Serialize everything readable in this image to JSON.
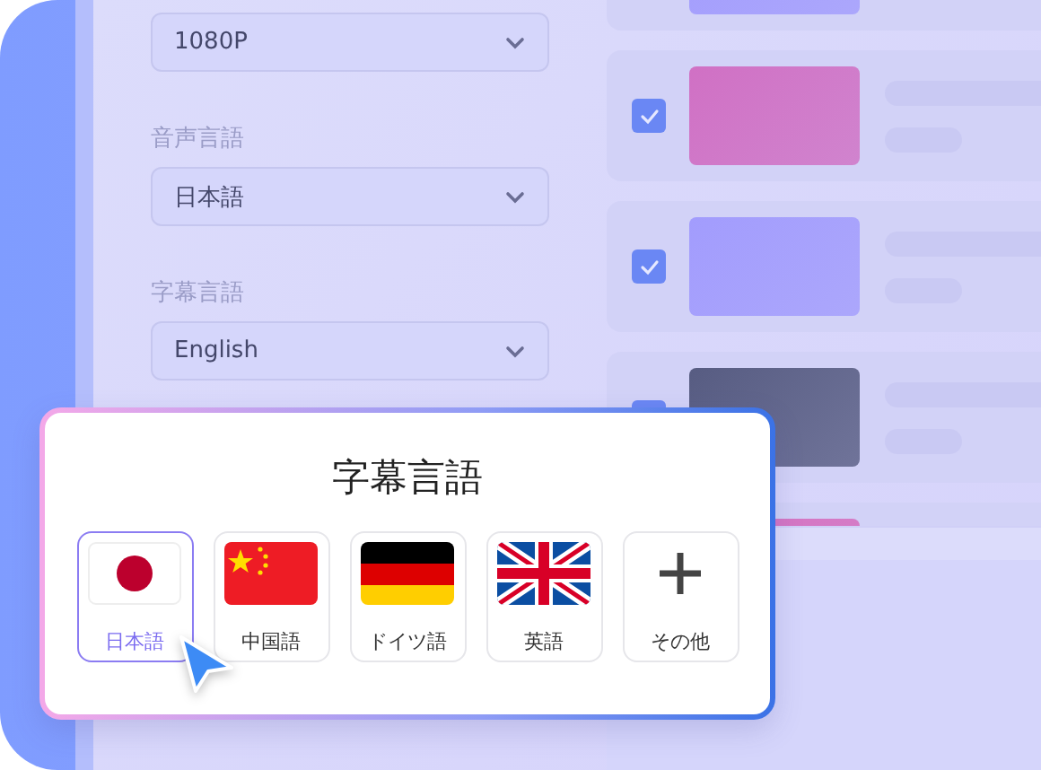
{
  "settings": [
    {
      "value": "1080P"
    },
    {
      "label": "音声言語",
      "value": "日本語"
    },
    {
      "label": "字幕言語",
      "value": "English"
    }
  ],
  "list": {
    "rows": [
      {
        "kind": "top",
        "color": "#a29cfd"
      },
      {
        "kind": "full",
        "checked": true,
        "color": "#d070c4"
      },
      {
        "kind": "full",
        "checked": true,
        "color": "#a29cfd"
      },
      {
        "kind": "overlapped",
        "checked": true,
        "color": "#575c82"
      },
      {
        "kind": "bottom",
        "color": "#d56fbf"
      }
    ]
  },
  "popup": {
    "title": "字幕言語",
    "options": [
      {
        "kind": "jp",
        "label": "日本語",
        "selected": true
      },
      {
        "kind": "cn",
        "label": "中国語",
        "selected": false
      },
      {
        "kind": "de",
        "label": "ドイツ語",
        "selected": false
      },
      {
        "kind": "gb",
        "label": "英語",
        "selected": false
      },
      {
        "kind": "more",
        "label": "その他",
        "selected": false
      }
    ]
  }
}
